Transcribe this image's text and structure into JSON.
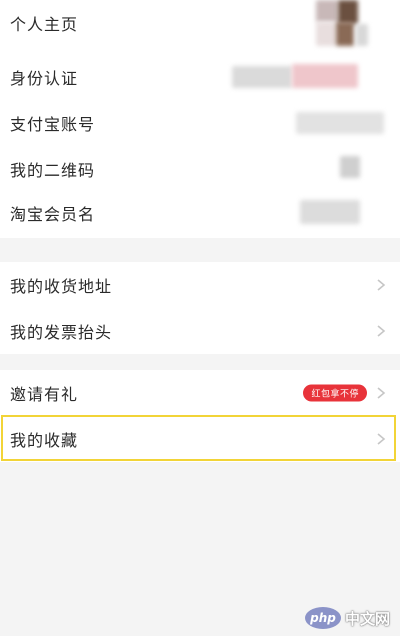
{
  "profile_section": {
    "items": [
      {
        "label": "个人主页"
      },
      {
        "label": "身份认证"
      },
      {
        "label": "支付宝账号"
      },
      {
        "label": "我的二维码"
      },
      {
        "label": "淘宝会员名"
      }
    ]
  },
  "address_section": {
    "items": [
      {
        "label": "我的收货地址"
      },
      {
        "label": "我的发票抬头"
      }
    ]
  },
  "misc_section": {
    "items": [
      {
        "label": "邀请有礼",
        "badge": "红包拿不停"
      },
      {
        "label": "我的收藏"
      }
    ]
  },
  "watermark": {
    "logo_text": "php",
    "site_text": "中文网"
  },
  "colors": {
    "badge_red": "#e8333a",
    "highlight_yellow": "#f2d437",
    "page_bg": "#f4f4f4"
  },
  "icons": [
    "chevron-right-icon"
  ]
}
